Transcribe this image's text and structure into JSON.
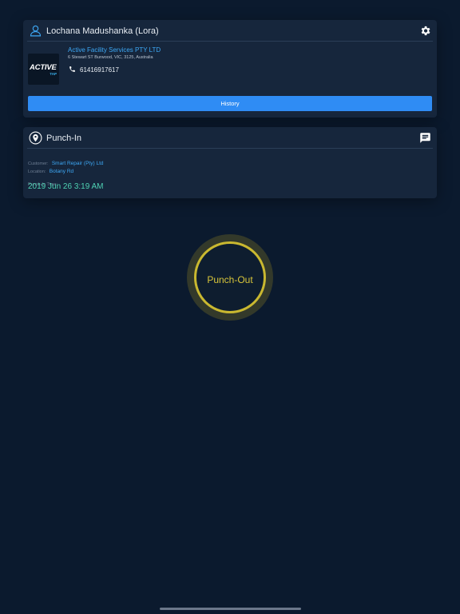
{
  "profile": {
    "user_name": "Lochana Madushanka (Lora)",
    "user_icon": "user-icon",
    "settings_icon": "gear-icon",
    "logo": {
      "main": "ACTIVE",
      "sub": "TAP"
    },
    "company_name": "Active Facility Services PTY LTD",
    "company_address": "6 Stewart ST Burwood, VIC, 3125, Australia",
    "phone_icon": "phone-icon",
    "phone": "61416917617",
    "history_label": "History"
  },
  "punch": {
    "title": "Punch-In",
    "title_icon": "location-pin-icon",
    "action_icon": "message-icon",
    "customer_label": "Customer:",
    "customer_value": "Smart Repair (Pty) Ltd",
    "location_label": "Location:",
    "location_value": "Botany Rd",
    "time_label": "Punch-In Time:",
    "time_value": "2019 Jun 26 3:19 AM"
  },
  "punch_out": {
    "label": "Punch-Out"
  },
  "colors": {
    "background": "#0b1a2e",
    "card": "#16263c",
    "accent_blue": "#2f8cf4",
    "link_blue": "#3da8f5",
    "time_green": "#4fd1b3",
    "punch_out_gold": "#c9b830"
  }
}
